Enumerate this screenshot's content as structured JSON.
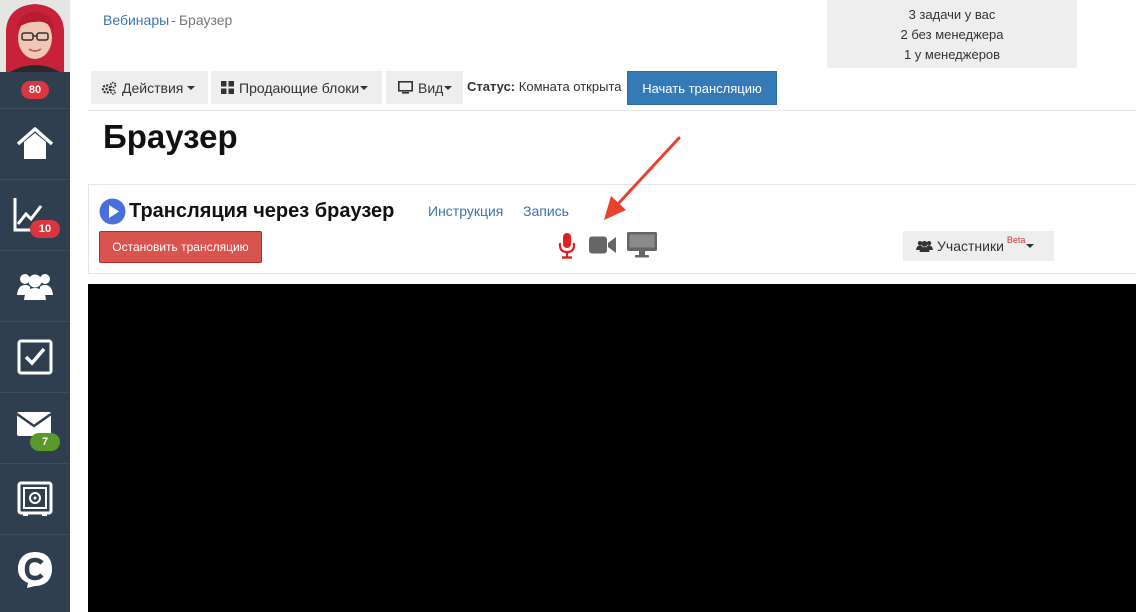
{
  "sidebar": {
    "avatar_badge": "80",
    "items": [
      {
        "name": "home",
        "icon": "home-icon"
      },
      {
        "name": "stats",
        "icon": "chart-icon",
        "badge": "10"
      },
      {
        "name": "users",
        "icon": "users-icon"
      },
      {
        "name": "tasks",
        "icon": "checkbox-icon"
      },
      {
        "name": "messages",
        "icon": "envelope-icon",
        "badge": "7"
      },
      {
        "name": "safe",
        "icon": "safe-icon"
      },
      {
        "name": "logo",
        "icon": "c-logo-icon"
      }
    ]
  },
  "breadcrumb": {
    "parent": "Вебинары",
    "separator": "-",
    "current": "Браузер"
  },
  "tasks": {
    "line1": "3 задачи у вас",
    "line2": "2 без менеджера",
    "line3": "1 у менеджеров"
  },
  "toolbar": {
    "actions_label": "Действия",
    "blocks_label": "Продающие блоки",
    "view_label": "Вид",
    "status_label": "Статус:",
    "status_value": "Комната открыта",
    "start_label": "Начать трансляцию"
  },
  "page": {
    "title": "Браузер"
  },
  "panel": {
    "title": "Трансляция через браузер",
    "instruction_link": "Инструкция",
    "record_link": "Запись",
    "stop_label": "Остановить трансляцию",
    "participants_label": "Участники",
    "beta_label": "Beta"
  },
  "colors": {
    "sidebar_bg": "#2f3f4f",
    "badge_red": "#d9363e",
    "badge_green": "#5a9a2b",
    "link": "#3d74ad",
    "primary": "#337ab7",
    "danger": "#d9534f",
    "mic_active": "#e0201c",
    "media_icon": "#666666",
    "annotation_arrow": "#e8412e"
  }
}
